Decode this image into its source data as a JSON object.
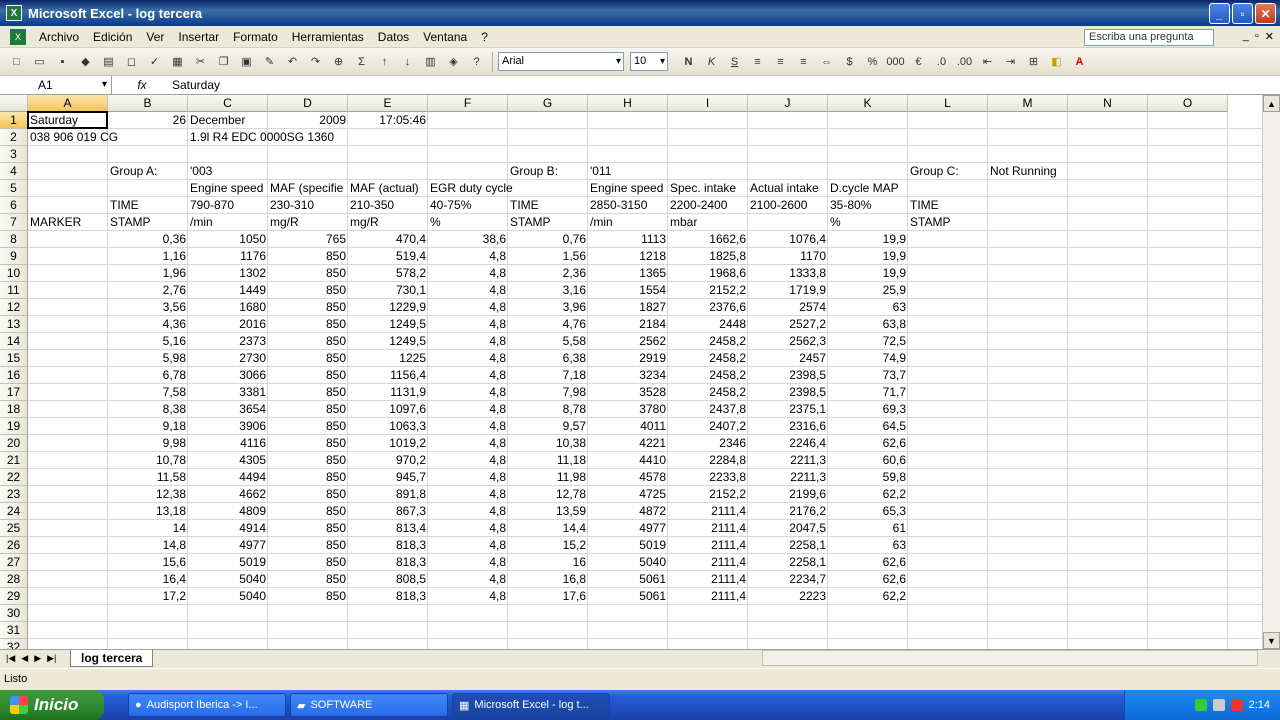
{
  "window": {
    "title": "Microsoft Excel - log tercera"
  },
  "menu": {
    "items": [
      "Archivo",
      "Edición",
      "Ver",
      "Insertar",
      "Formato",
      "Herramientas",
      "Datos",
      "Ventana",
      "?"
    ],
    "ask_placeholder": "Escriba una pregunta"
  },
  "toolbar": {
    "font": "Arial",
    "size": "10"
  },
  "formula": {
    "cell_ref": "A1",
    "fx": "fx",
    "value": "Saturday"
  },
  "columns": [
    "A",
    "B",
    "C",
    "D",
    "E",
    "F",
    "G",
    "H",
    "I",
    "J",
    "K",
    "L",
    "M",
    "N",
    "O"
  ],
  "rows": [
    "1",
    "2",
    "3",
    "4",
    "5",
    "6",
    "7",
    "8",
    "9",
    "10",
    "11",
    "12",
    "13",
    "14",
    "15",
    "16",
    "17",
    "18",
    "19",
    "20",
    "21",
    "22",
    "23",
    "24",
    "25",
    "26",
    "27",
    "28",
    "29",
    "30",
    "31",
    "32"
  ],
  "header_cells": {
    "r1": {
      "A": "Saturday",
      "B": "26",
      "C": "December",
      "D": "2009",
      "E": "17:05:46"
    },
    "r2": {
      "A": "038 906 019 CG",
      "C": "1.9l R4 EDC 0000SG  1360"
    },
    "r4": {
      "B": "Group A:",
      "C": "'003",
      "G": "Group B:",
      "H": "'011",
      "L": "Group C:",
      "M": "Not Running"
    },
    "r5": {
      "C": "Engine speed",
      "D": "MAF (specifie",
      "E": "MAF (actual)",
      "F": "EGR duty cycle",
      "H": "Engine speed",
      "I": "Spec. intake",
      "J": "Actual intake",
      "K": "D.cycle MAP"
    },
    "r6": {
      "B": "TIME",
      "C": "790-870",
      "D": "230-310",
      "E": "210-350",
      "F": "40-75%",
      "G": "TIME",
      "H": "2850-3150",
      "I": "2200-2400",
      "J": "2100-2600",
      "K": "35-80%",
      "L": "TIME"
    },
    "r7": {
      "A": "MARKER",
      "B": "STAMP",
      "C": " /min",
      "D": " mg/R",
      "E": " mg/R",
      "F": " %",
      "G": "STAMP",
      "H": " /min",
      "I": " mbar",
      "K": " %",
      "L": "STAMP"
    }
  },
  "data_rows": [
    [
      "0,36",
      "1050",
      "765",
      "470,4",
      "38,6",
      "0,76",
      "1113",
      "1662,6",
      "1076,4",
      "19,9"
    ],
    [
      "1,16",
      "1176",
      "850",
      "519,4",
      "4,8",
      "1,56",
      "1218",
      "1825,8",
      "1170",
      "19,9"
    ],
    [
      "1,96",
      "1302",
      "850",
      "578,2",
      "4,8",
      "2,36",
      "1365",
      "1968,6",
      "1333,8",
      "19,9"
    ],
    [
      "2,76",
      "1449",
      "850",
      "730,1",
      "4,8",
      "3,16",
      "1554",
      "2152,2",
      "1719,9",
      "25,9"
    ],
    [
      "3,56",
      "1680",
      "850",
      "1229,9",
      "4,8",
      "3,96",
      "1827",
      "2376,6",
      "2574",
      "63"
    ],
    [
      "4,36",
      "2016",
      "850",
      "1249,5",
      "4,8",
      "4,76",
      "2184",
      "2448",
      "2527,2",
      "63,8"
    ],
    [
      "5,16",
      "2373",
      "850",
      "1249,5",
      "4,8",
      "5,58",
      "2562",
      "2458,2",
      "2562,3",
      "72,5"
    ],
    [
      "5,98",
      "2730",
      "850",
      "1225",
      "4,8",
      "6,38",
      "2919",
      "2458,2",
      "2457",
      "74,9"
    ],
    [
      "6,78",
      "3066",
      "850",
      "1156,4",
      "4,8",
      "7,18",
      "3234",
      "2458,2",
      "2398,5",
      "73,7"
    ],
    [
      "7,58",
      "3381",
      "850",
      "1131,9",
      "4,8",
      "7,98",
      "3528",
      "2458,2",
      "2398,5",
      "71,7"
    ],
    [
      "8,38",
      "3654",
      "850",
      "1097,6",
      "4,8",
      "8,78",
      "3780",
      "2437,8",
      "2375,1",
      "69,3"
    ],
    [
      "9,18",
      "3906",
      "850",
      "1063,3",
      "4,8",
      "9,57",
      "4011",
      "2407,2",
      "2316,6",
      "64,5"
    ],
    [
      "9,98",
      "4116",
      "850",
      "1019,2",
      "4,8",
      "10,38",
      "4221",
      "2346",
      "2246,4",
      "62,6"
    ],
    [
      "10,78",
      "4305",
      "850",
      "970,2",
      "4,8",
      "11,18",
      "4410",
      "2284,8",
      "2211,3",
      "60,6"
    ],
    [
      "11,58",
      "4494",
      "850",
      "945,7",
      "4,8",
      "11,98",
      "4578",
      "2233,8",
      "2211,3",
      "59,8"
    ],
    [
      "12,38",
      "4662",
      "850",
      "891,8",
      "4,8",
      "12,78",
      "4725",
      "2152,2",
      "2199,6",
      "62,2"
    ],
    [
      "13,18",
      "4809",
      "850",
      "867,3",
      "4,8",
      "13,59",
      "4872",
      "2111,4",
      "2176,2",
      "65,3"
    ],
    [
      "14",
      "4914",
      "850",
      "813,4",
      "4,8",
      "14,4",
      "4977",
      "2111,4",
      "2047,5",
      "61"
    ],
    [
      "14,8",
      "4977",
      "850",
      "818,3",
      "4,8",
      "15,2",
      "5019",
      "2111,4",
      "2258,1",
      "63"
    ],
    [
      "15,6",
      "5019",
      "850",
      "818,3",
      "4,8",
      "16",
      "5040",
      "2111,4",
      "2258,1",
      "62,6"
    ],
    [
      "16,4",
      "5040",
      "850",
      "808,5",
      "4,8",
      "16,8",
      "5061",
      "2111,4",
      "2234,7",
      "62,6"
    ],
    [
      "17,2",
      "5040",
      "850",
      "818,3",
      "4,8",
      "17,6",
      "5061",
      "2111,4",
      "2223",
      "62,2"
    ]
  ],
  "sheet": {
    "tab": "log tercera"
  },
  "status": {
    "text": "Listo"
  },
  "taskbar": {
    "start": "Inicio",
    "tasks": [
      "Audisport Iberica -> I...",
      "SOFTWARE",
      "Microsoft Excel - log t..."
    ],
    "clock": "2:14"
  }
}
